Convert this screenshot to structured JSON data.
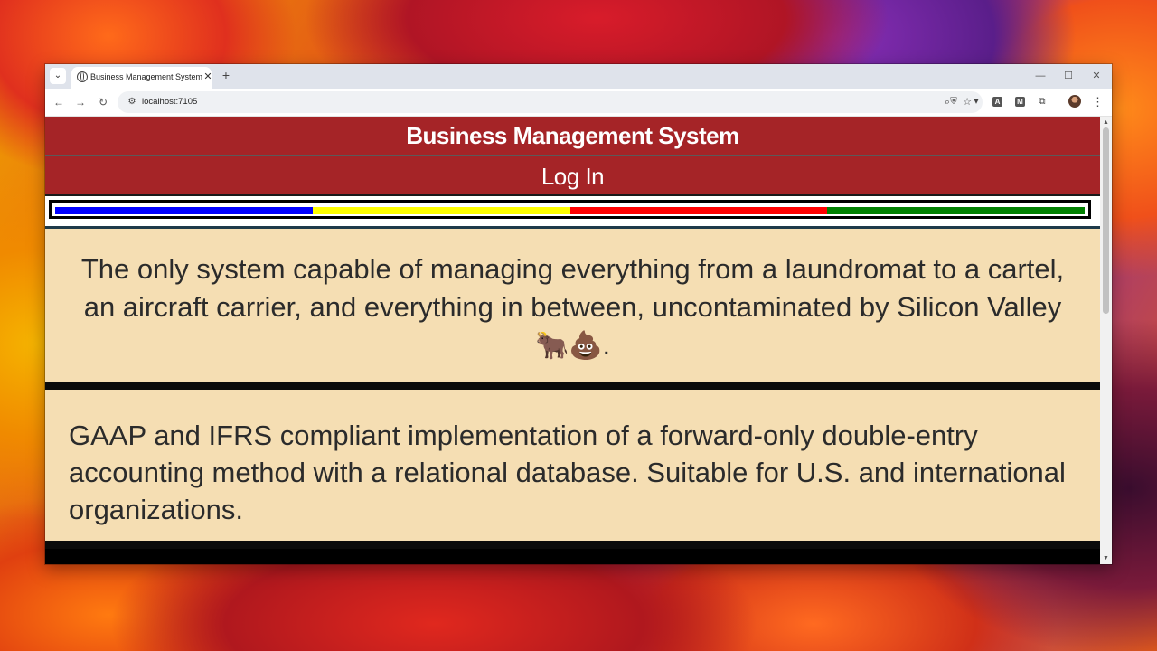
{
  "browser": {
    "tab_title": "Business Management System",
    "tab_close": "✕",
    "new_tab": "+",
    "url": "localhost:7105",
    "icons": [
      "tab-search-icon",
      "globe-icon",
      "back-icon",
      "forward-icon",
      "reload-icon",
      "site-info-icon",
      "zoom-icon",
      "star-icon",
      "shield-extension-icon",
      "vue-extension-icon",
      "extension-a-icon",
      "extension-m-icon",
      "puzzle-icon",
      "avatar",
      "menu-icon"
    ],
    "window_controls": {
      "minimize": "—",
      "maximize": "☐",
      "close": "✕"
    },
    "extensions": {
      "a": "A",
      "m": "M"
    }
  },
  "page": {
    "header_title": "Business Management System",
    "login_label": "Log In",
    "stripe_colors": [
      "#0000ff",
      "#ffff00",
      "#ff0000",
      "#008000"
    ],
    "tagline": "The only system capable of managing everything from a laundromat to a cartel, an aircraft carrier, and everything in between, uncontaminated by Silicon Valley",
    "tagline_emoji": "🐂💩.",
    "description": "GAAP and IFRS compliant implementation of a forward-only double-entry accounting method with a relational database. Suitable for U.S. and international organizations."
  },
  "colors": {
    "banner": "#a52427",
    "panel": "#f5deb3",
    "text": "#2b2b2b"
  }
}
